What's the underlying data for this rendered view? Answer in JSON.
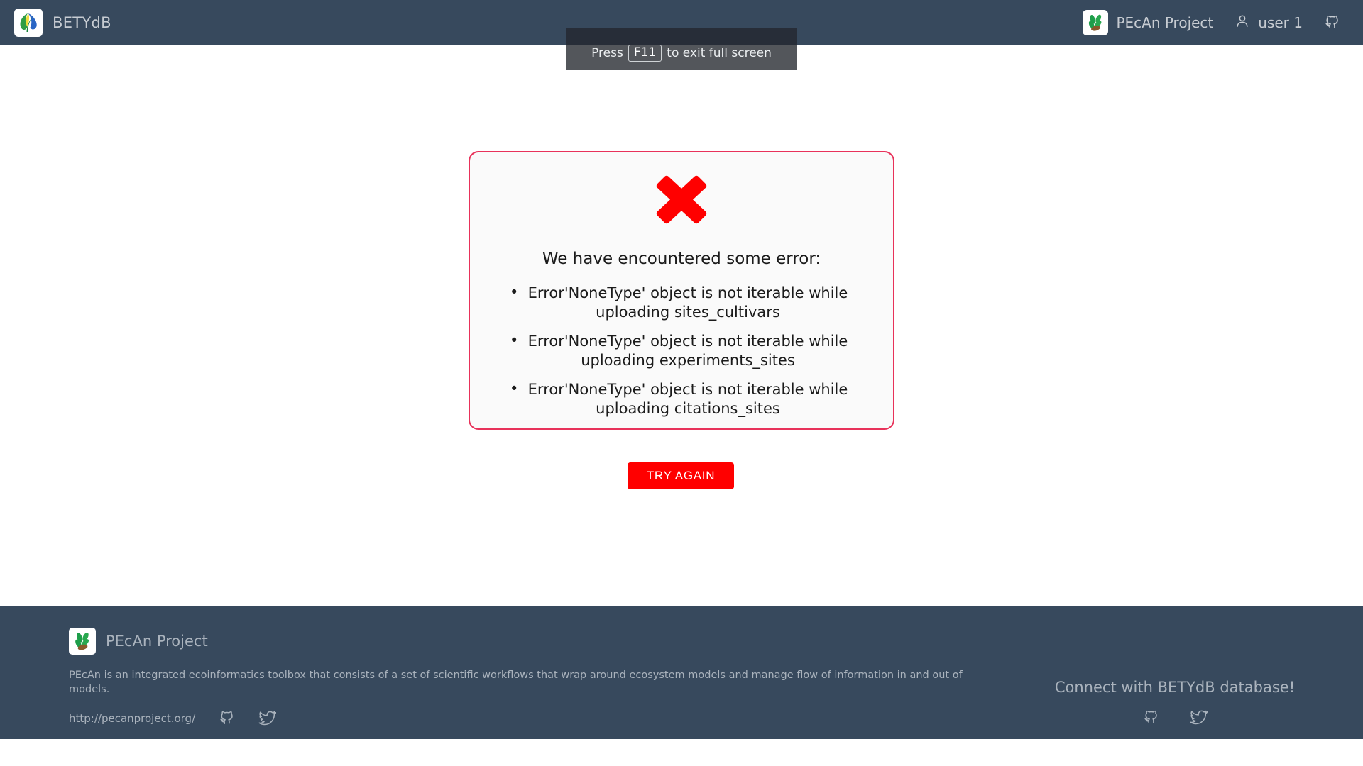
{
  "header": {
    "brand_label": "BETYdB",
    "brand_logo_icon": "betydb-leaf-logo-icon",
    "right": {
      "project_label": "PEcAn Project",
      "project_logo_icon": "pecan-leaf-logo-icon",
      "user_label": "user 1",
      "user_icon": "person-icon",
      "github_icon": "github-icon"
    },
    "background_color": "#37495D",
    "text_color": "#C7CCD2"
  },
  "fullscreen_toast": {
    "prefix": "Press",
    "key": "F11",
    "suffix": "to exit full screen",
    "background_color": "#53565B"
  },
  "main": {
    "error_card": {
      "status_icon": "red-x-error-icon",
      "heading": "We have encountered some error:",
      "errors": [
        "Error'NoneType' object is not iterable while uploading sites_cultivars",
        "Error'NoneType' object is not iterable while uploading experiments_sites",
        "Error'NoneType' object is not iterable while uploading citations_sites"
      ],
      "border_color": "#E8325A",
      "background_color": "#FAFAFA",
      "icon_color": "#FF0000"
    },
    "try_again_label": "TRY AGAIN",
    "try_again_color": "#FF0000"
  },
  "footer": {
    "brand_label": "PEcAn Project",
    "brand_logo_icon": "pecan-leaf-logo-icon",
    "description": "PEcAn is an integrated ecoinformatics toolbox that consists of a set of scientific workflows that wrap around ecosystem models and manage flow of information in and out of models.",
    "url_label": "http://pecanproject.org/",
    "github_icon": "github-icon",
    "twitter_icon": "twitter-icon",
    "connect_title": "Connect with BETYdB database!",
    "background_color": "#37495D",
    "text_color": "#AAB3BD"
  }
}
